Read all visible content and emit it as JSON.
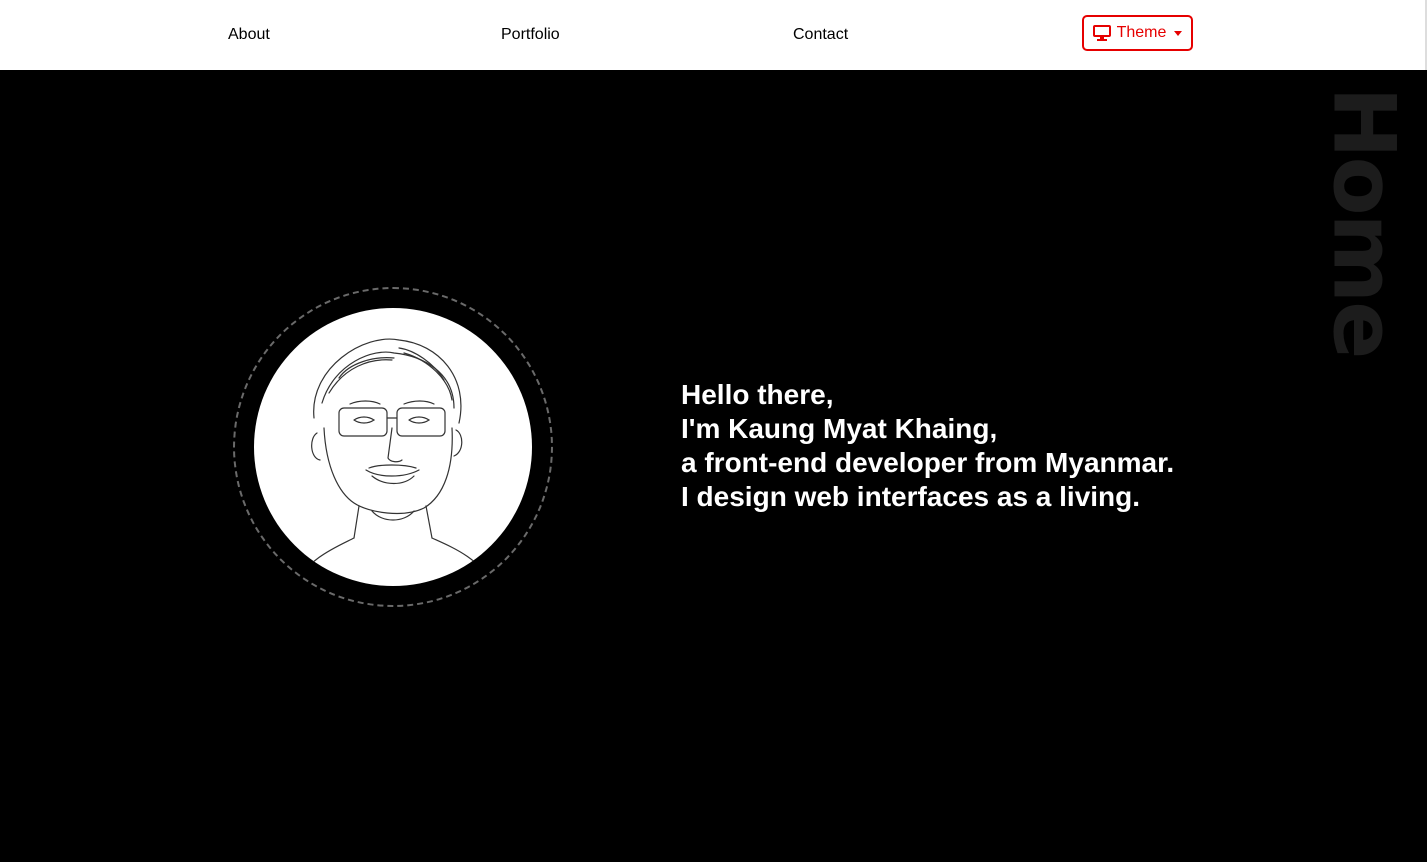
{
  "nav": {
    "about": "About",
    "portfolio": "Portfolio",
    "contact": "Contact",
    "theme_label": "Theme",
    "theme_icon": "desktop-icon",
    "accent": "#e60000"
  },
  "section_title": "Home",
  "intro": {
    "line1": "Hello there,",
    "line2": "I'm Kaung Myat Khaing,",
    "line3": "a front-end developer from Myanmar.",
    "line4": "I design web interfaces as a living."
  },
  "colors": {
    "background": "#000000",
    "navbar": "#ffffff",
    "text": "#ffffff"
  }
}
